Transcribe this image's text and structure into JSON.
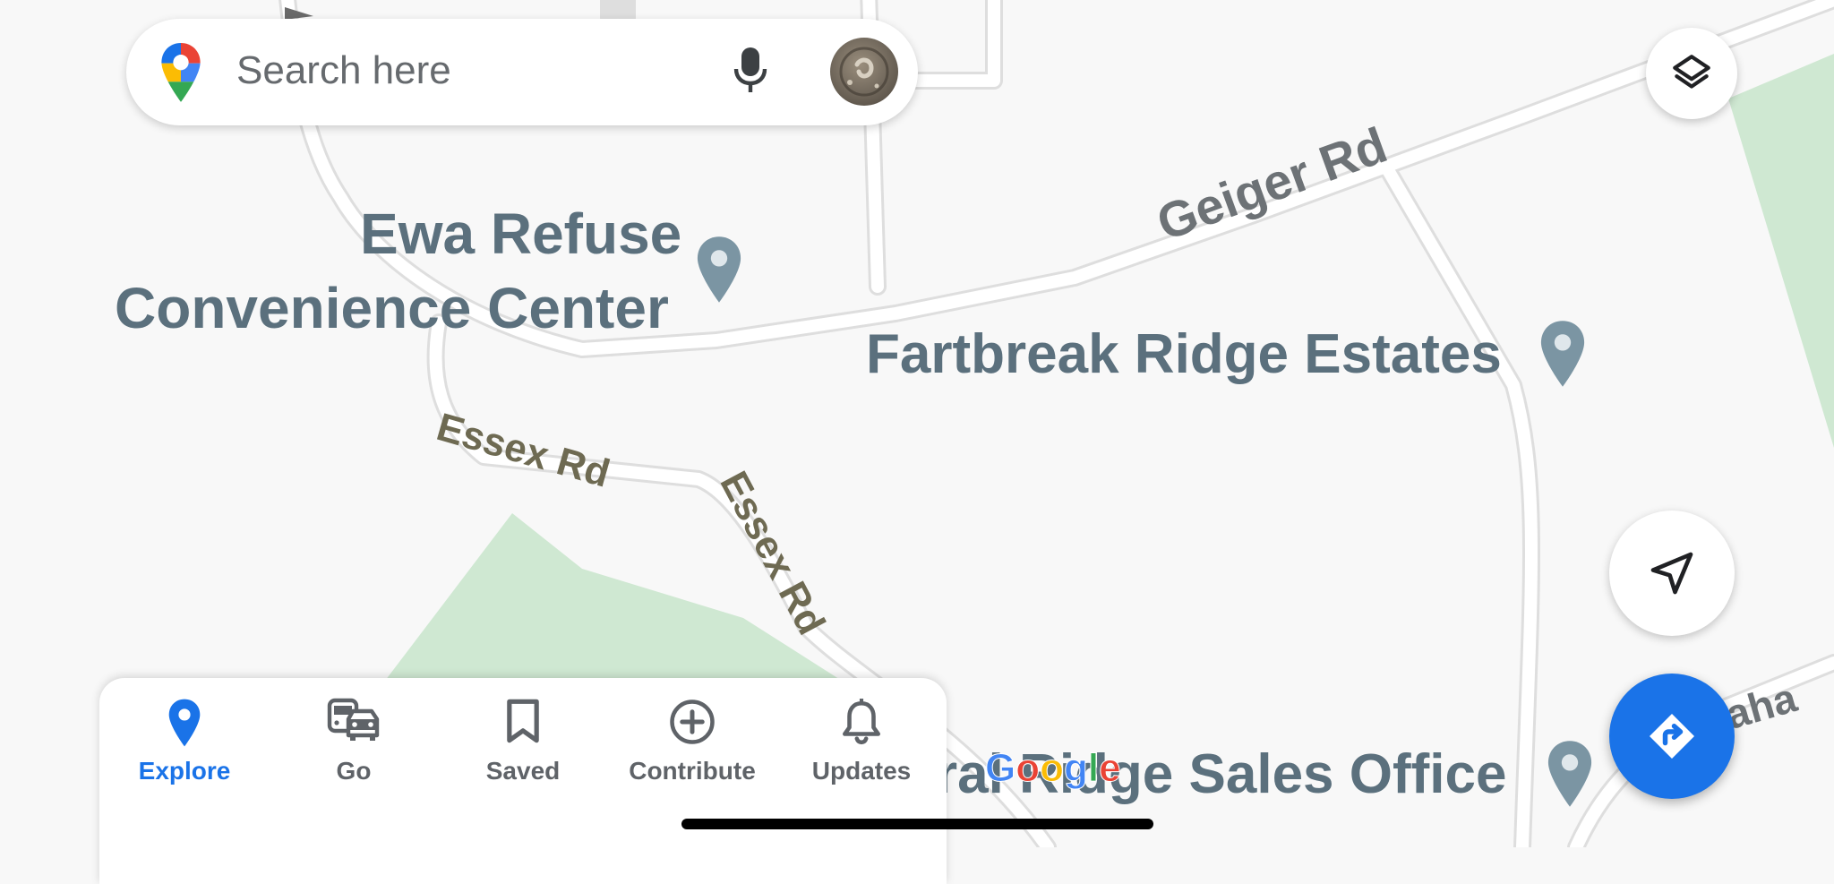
{
  "search": {
    "placeholder": "Search here"
  },
  "map": {
    "pois": [
      {
        "id": "ewa",
        "lines": [
          "Ewa Refuse",
          "Convenience Center"
        ]
      },
      {
        "id": "fartbreak",
        "name": "Fartbreak Ridge Estates"
      },
      {
        "id": "sales",
        "name": "ral Ridge Sales Office"
      }
    ],
    "roads": [
      {
        "id": "geiger",
        "name": "Geiger Rd"
      },
      {
        "id": "essex1",
        "name": "Essex Rd"
      },
      {
        "id": "essex2",
        "name": "Essex Rd"
      },
      {
        "id": "aha",
        "name": "aha"
      }
    ],
    "attribution": {
      "letters": [
        "G",
        "o",
        "o",
        "g",
        "l",
        "e"
      ],
      "colors": [
        "#4285f4",
        "#ea4335",
        "#fbbc05",
        "#4285f4",
        "#34a853",
        "#ea4335"
      ]
    }
  },
  "bottom_nav": {
    "items": [
      {
        "label": "Explore",
        "icon": "explore-pin-icon",
        "active": true
      },
      {
        "label": "Go",
        "icon": "commute-icon",
        "active": false
      },
      {
        "label": "Saved",
        "icon": "bookmark-icon",
        "active": false
      },
      {
        "label": "Contribute",
        "icon": "add-circle-icon",
        "active": false
      },
      {
        "label": "Updates",
        "icon": "bell-icon",
        "active": false
      }
    ]
  },
  "colors": {
    "accent": "#1a73e8",
    "poi_text": "#5b707d",
    "park": "#cfe8d2",
    "road": "#ffffff",
    "road_outline": "#dcdcdc"
  }
}
